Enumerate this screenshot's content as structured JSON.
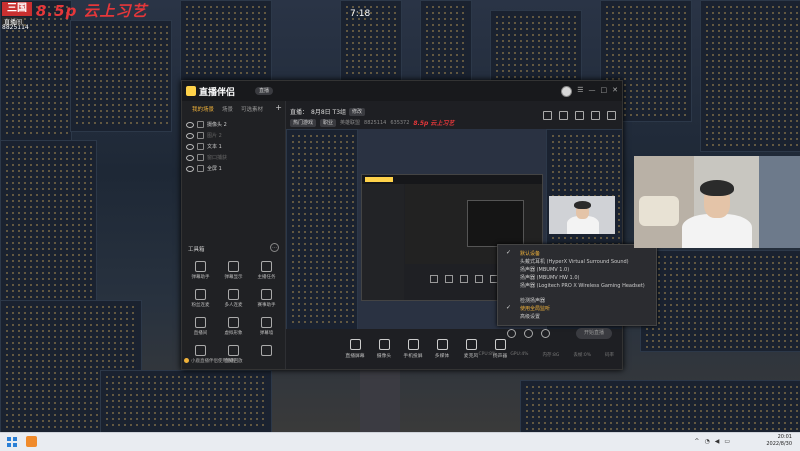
{
  "overlay": {
    "room_logo": "三国",
    "room_tag": "直播间",
    "room_id": "8825114",
    "red_title": "8.5p 云上习艺",
    "clock_sign": "7:18"
  },
  "app": {
    "name": "直播伴侣",
    "version_pill": "直播",
    "tabs": [
      "我的场景",
      "场景",
      "可选素材"
    ],
    "sources": [
      {
        "label": "摄像头 2",
        "dim": false
      },
      {
        "label": "图片 2",
        "dim": true
      },
      {
        "label": "文本 1",
        "dim": false
      },
      {
        "label": "窗口捕获",
        "dim": true
      },
      {
        "label": "全屏 1",
        "dim": false
      }
    ],
    "toolbox_title": "工具箱",
    "tools": [
      "弹幕助手",
      "弹幕显示",
      "主播任务",
      "粉丝连麦",
      "多人连麦",
      "赛事助手",
      "直播间",
      "虚拟形象",
      "弹幕墙",
      "",
      "直播回放",
      ""
    ],
    "promo": "小鹿直播伴侣使用教程",
    "info": {
      "title_prefix": "直播：",
      "title": "8月8日 T3组",
      "edit": "修改",
      "tag1": "热门游戏",
      "tag2": "职业",
      "category": "英雄联盟",
      "room_no": "8825114",
      "fans": "635372",
      "red_mark": "8.5p 云上习艺"
    },
    "bottom_bar": [
      "直播屏幕",
      "摄像头",
      "手机投屏",
      "多媒体",
      "麦克风",
      "扬声器"
    ],
    "status_items": [
      "CPU:8%",
      "GPU:4%",
      "内存:8G",
      "丢帧:0%",
      "码率"
    ],
    "go_live": "开始直播"
  },
  "dropdown": {
    "items": [
      {
        "label": "默认设备",
        "check": true,
        "hl": true
      },
      {
        "label": "头戴式耳机 (HyperX Virtual Surround Sound)",
        "check": false,
        "hl": false
      },
      {
        "label": "扬声器 (MBUMV 1.0)",
        "check": false,
        "hl": false
      },
      {
        "label": "扬声器 (MBUMV HW 1.0)",
        "check": false,
        "hl": false
      },
      {
        "label": "扬声器 (Logitech PRO X Wireless Gaming Headset)",
        "check": false,
        "hl": false
      },
      {
        "label": "检测扬声器",
        "check": false,
        "hl": false
      },
      {
        "label": "使用全局监听",
        "check": true,
        "hl": true
      },
      {
        "label": "高级设置",
        "check": false,
        "hl": false
      }
    ]
  },
  "taskbar": {
    "time": "20:01",
    "date": "2022/8/30"
  }
}
